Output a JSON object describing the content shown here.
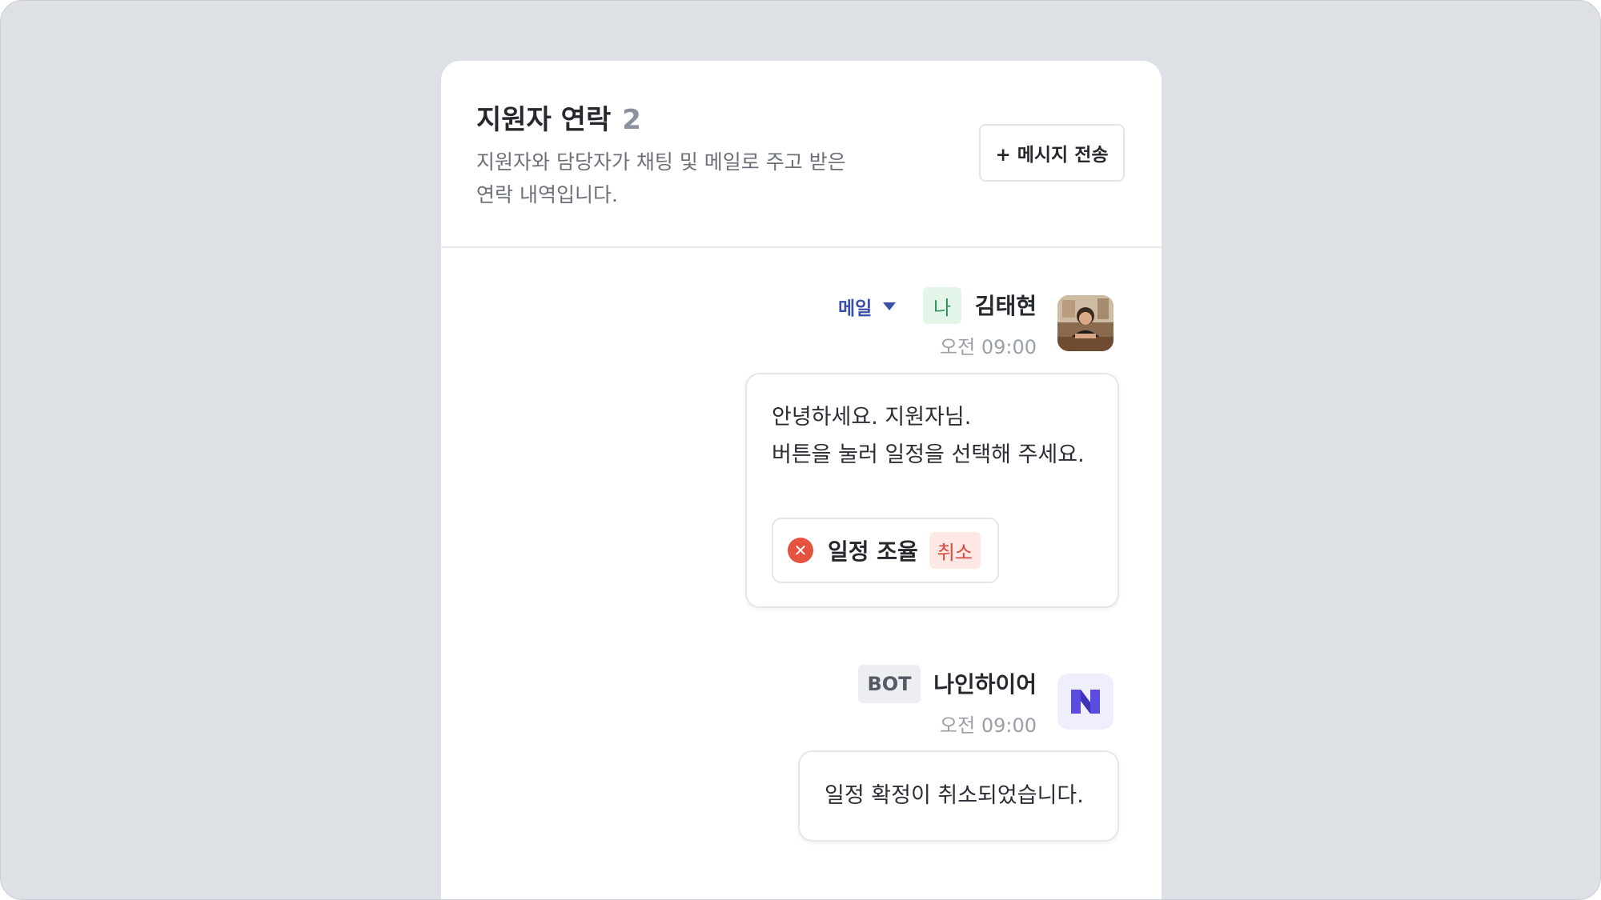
{
  "panel": {
    "title": "지원자 연락",
    "count": "2",
    "description_line1": "지원자와 담당자가 채팅 및 메일로 주고 받은",
    "description_line2": "연락 내역입니다.",
    "send_button_label": "+ 메시지 전송"
  },
  "messages": [
    {
      "channel": "메일",
      "sender_badge": "나",
      "sender_name": "김태현",
      "time": "오전 09:00",
      "avatar": "user-photo",
      "body_line1": "안녕하세요. 지원자님.",
      "body_line2": "버튼을 눌러 일정을 선택해 주세요.",
      "schedule_label": "일정 조율",
      "schedule_status": "취소",
      "schedule_icon": "x-circle-icon"
    },
    {
      "sender_badge": "BOT",
      "sender_name": "나인하이어",
      "time": "오전 09:00",
      "avatar": "ninehire-logo",
      "body_line1": "일정 확정이 취소되었습니다."
    }
  ],
  "colors": {
    "background": "#dde0e4",
    "channel": "#3b4fa8",
    "me_badge_bg": "#e4f6ea",
    "me_badge_text": "#2f8f5b",
    "cancel_bg": "#fde8e6",
    "cancel_text": "#d9473a",
    "logo_accent": "#5b4ce0"
  }
}
